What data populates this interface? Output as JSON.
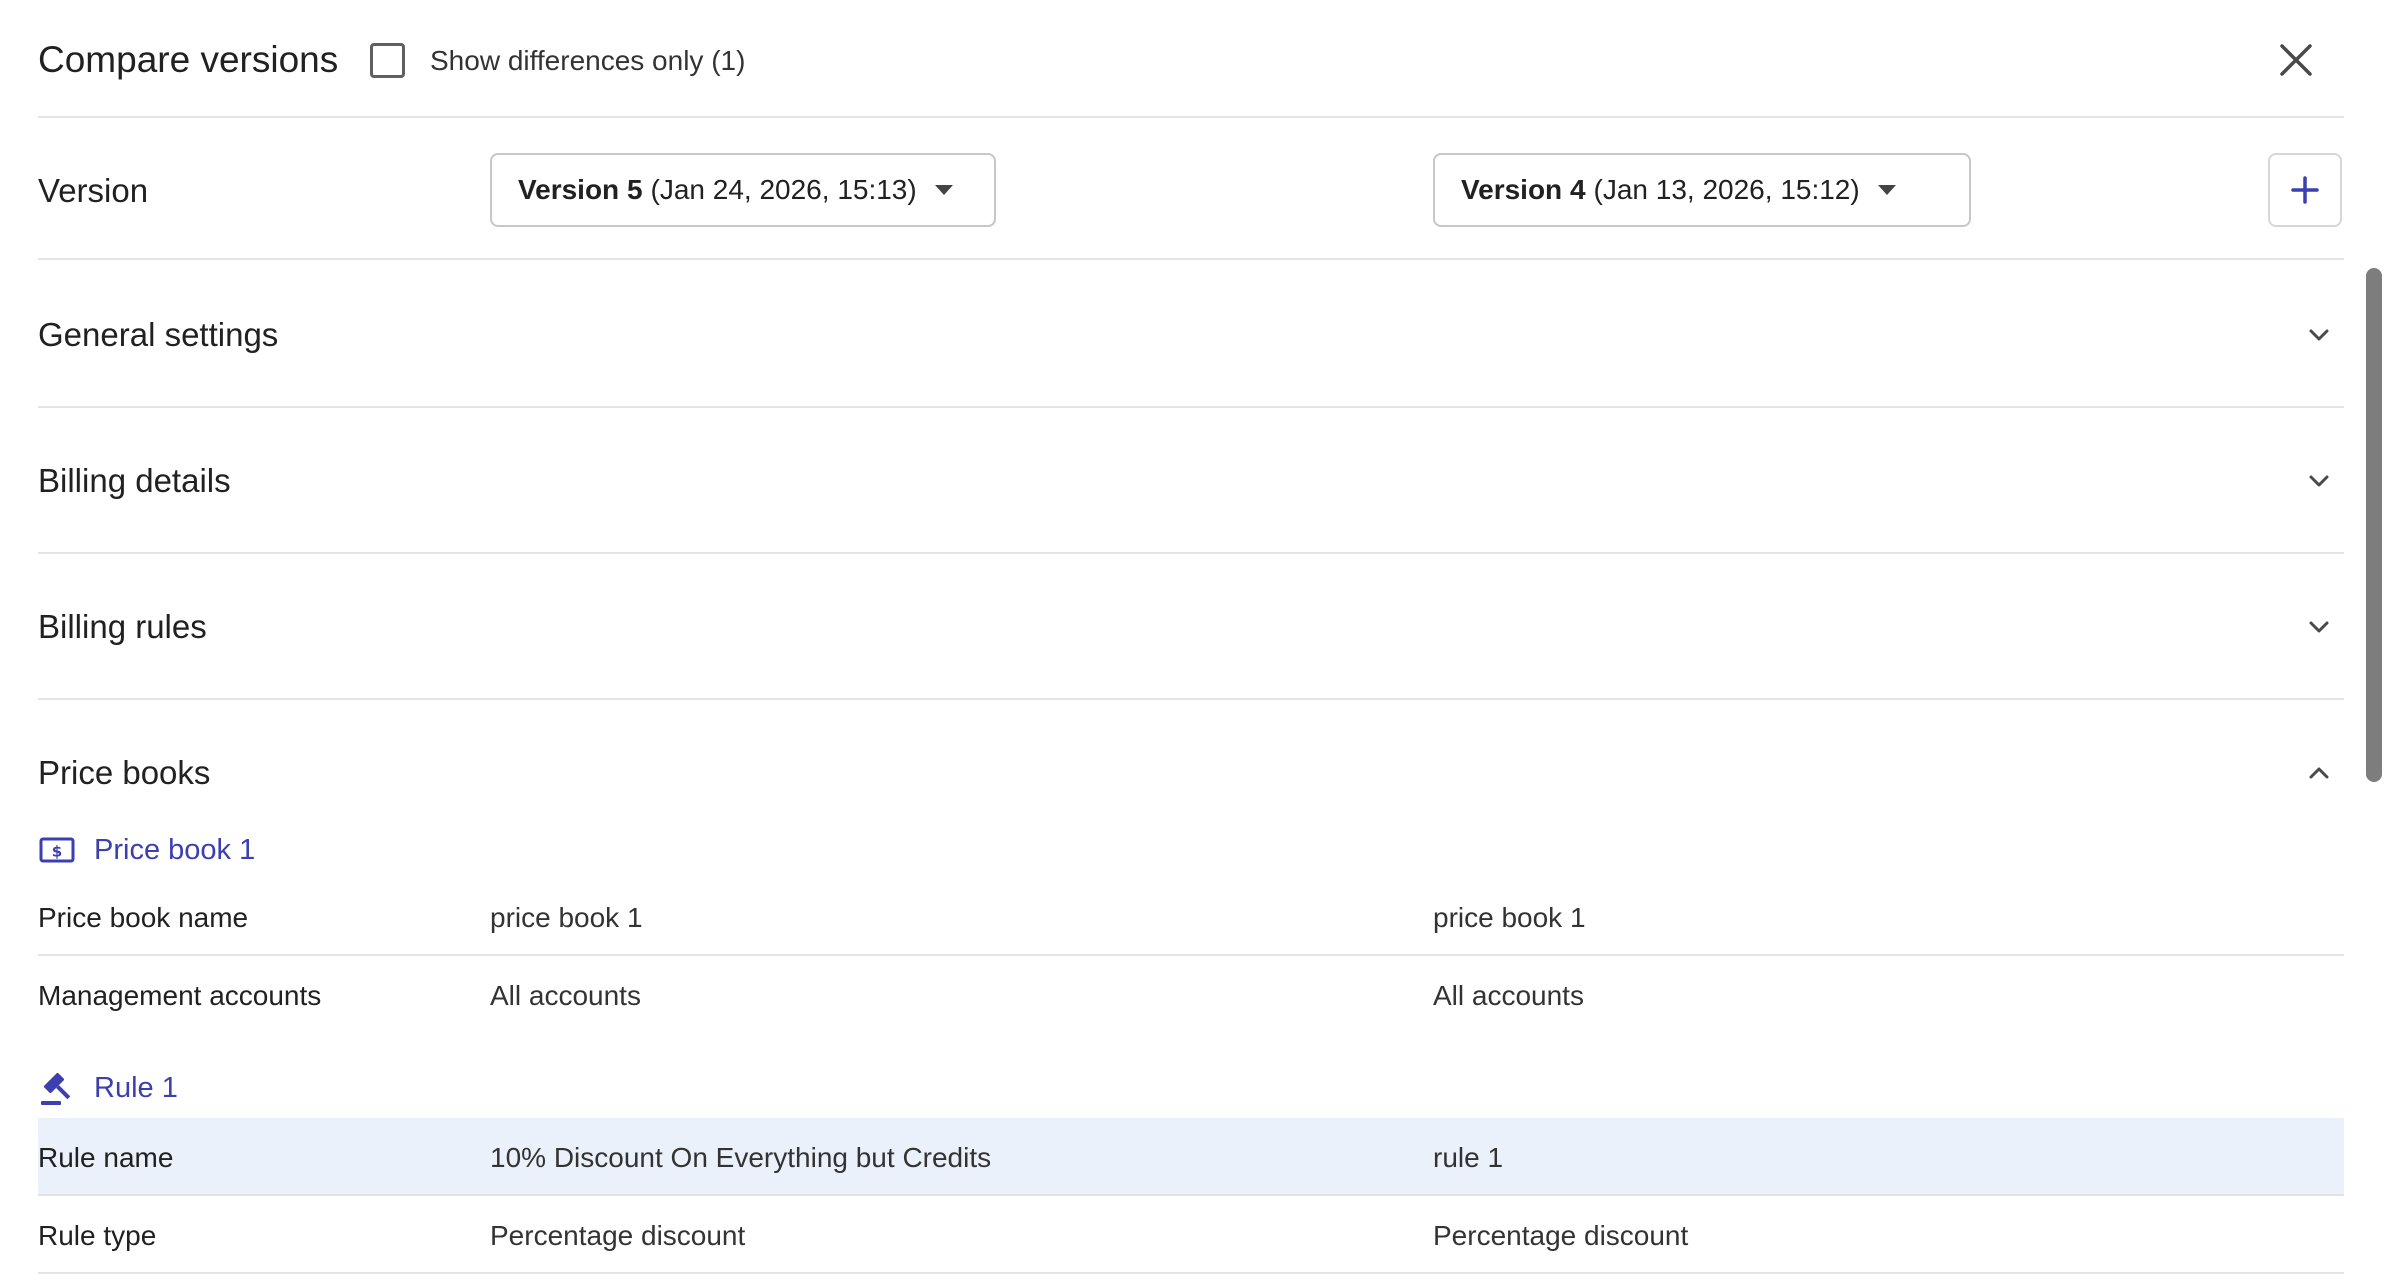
{
  "header": {
    "title": "Compare versions",
    "show_differences_label": "Show differences only (1)",
    "show_differences_checked": false
  },
  "version_row": {
    "label": "Version",
    "left": {
      "bold": "Version 5",
      "rest": "(Jan 24, 2026, 15:13)"
    },
    "right": {
      "bold": "Version 4",
      "rest": "(Jan 13, 2026, 15:12)"
    }
  },
  "sections": {
    "general_settings": "General settings",
    "billing_details": "Billing details",
    "billing_rules": "Billing rules",
    "price_books": "Price books"
  },
  "price_book": {
    "heading": "Price book 1",
    "rows": [
      {
        "label": "Price book name",
        "left": "price book 1",
        "right": "price book 1"
      },
      {
        "label": "Management accounts",
        "left": "All accounts",
        "right": "All accounts"
      }
    ]
  },
  "rule": {
    "heading": "Rule 1",
    "rows": [
      {
        "label": "Rule name",
        "left": "10% Discount On Everything but Credits",
        "right": "rule 1",
        "different": true
      },
      {
        "label": "Rule type",
        "left": "Percentage discount",
        "right": "Percentage discount",
        "different": false
      }
    ]
  },
  "colors": {
    "accent": "#3b3fb0",
    "diff_highlight": "#eaf1fb",
    "divider": "#e3e3e3"
  },
  "icons": {
    "close": "close-icon",
    "add": "plus-icon",
    "expand": "chevron-down-icon",
    "collapse": "chevron-up-icon",
    "price_book": "money-icon",
    "rule": "gavel-icon",
    "caret": "caret-down-icon"
  }
}
